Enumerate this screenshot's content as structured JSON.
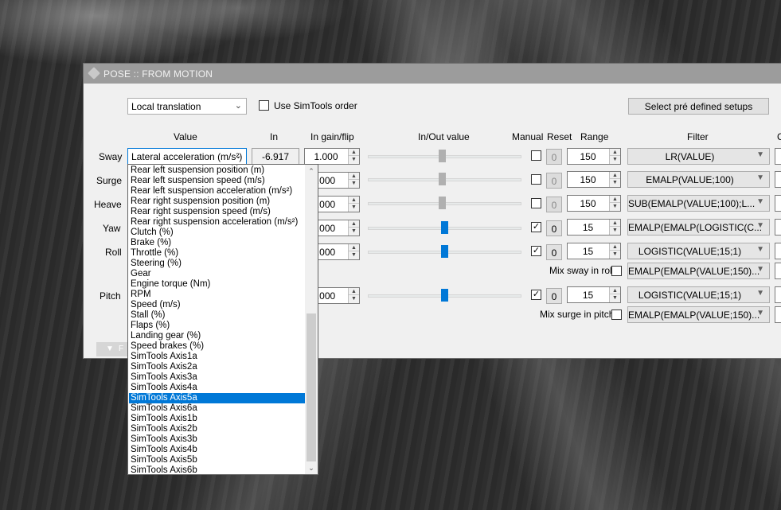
{
  "window": {
    "title": "POSE :: FROM MOTION"
  },
  "top": {
    "mode_value": "Local translation",
    "use_simtools_label": "Use SimTools order",
    "select_setups_label": "Select pré defined setups"
  },
  "headers": {
    "value": "Value",
    "in": "In",
    "in_gain": "In gain/flip",
    "inout": "In/Out value",
    "manual": "Manual",
    "reset": "Reset",
    "range": "Range",
    "filter": "Filter",
    "cut": "C"
  },
  "rows": [
    {
      "label": "Sway",
      "value": "Lateral acceleration (m/s²)",
      "in": "-6.917",
      "gain": "1.000",
      "manual_checked": false,
      "reset": "0",
      "range": "150",
      "filter": "LR(VALUE)",
      "inout_fraction": 0.55
    },
    {
      "label": "Surge",
      "gain": ".000",
      "manual_checked": false,
      "reset": "0",
      "range": "150",
      "filter": "EMALP(VALUE;100)",
      "inout_fraction": 0.55
    },
    {
      "label": "Heave",
      "gain": ".000",
      "manual_checked": false,
      "reset": "0",
      "range": "150",
      "filter": "SUB(EMALP(VALUE;100);L...",
      "inout_fraction": 0.55
    },
    {
      "label": "Yaw",
      "gain": ".000",
      "manual_checked": true,
      "reset": "0",
      "range": "15",
      "filter": "EMALP(EMALP(LOGISTIC(C...",
      "inout_fraction": 0.57
    },
    {
      "label": "Roll",
      "gain": ".000",
      "manual_checked": true,
      "reset": "0",
      "range": "15",
      "filter": "LOGISTIC(VALUE;15;1)",
      "inout_fraction": 0.57
    },
    {
      "label": "Pitch",
      "gain": ".000",
      "manual_checked": true,
      "reset": "0",
      "range": "15",
      "filter": "LOGISTIC(VALUE;15;1)",
      "inout_fraction": 0.57
    }
  ],
  "mix": {
    "sway_in_roll_label": "Mix sway in roll",
    "sway_in_roll_filter": "EMALP(EMALP(VALUE;150)...",
    "surge_in_pitch_label": "Mix surge in pitch",
    "surge_in_pitch_filter": "EMALP(EMALP(VALUE;150)..."
  },
  "collapsed_tab_label": "F",
  "dropdown": {
    "selected": "SimTools Axis5a",
    "items": [
      "Rear left suspension position (m)",
      "Rear left suspension speed (m/s)",
      "Rear left suspension acceleration (m/s²)",
      "Rear right suspension position (m)",
      "Rear right suspension speed (m/s)",
      "Rear right suspension acceleration (m/s²)",
      "Clutch (%)",
      "Brake (%)",
      "Throttle (%)",
      "Steering (%)",
      "Gear",
      "Engine torque (Nm)",
      "RPM",
      "Speed (m/s)",
      "Stall (%)",
      "Flaps (%)",
      "Landing gear (%)",
      "Speed brakes (%)",
      "SimTools Axis1a",
      "SimTools Axis2a",
      "SimTools Axis3a",
      "SimTools Axis4a",
      "SimTools Axis5a",
      "SimTools Axis6a",
      "SimTools Axis1b",
      "SimTools Axis2b",
      "SimTools Axis3b",
      "SimTools Axis4b",
      "SimTools Axis5b",
      "SimTools Axis6b"
    ]
  },
  "icons": {
    "dropdown_arrow": "chevron-down-icon",
    "filter_arrow": "triangle-down-icon",
    "spin_up": "triangle-up-icon",
    "spin_down": "triangle-down-icon",
    "checkmark": "check-icon"
  },
  "colors": {
    "accent": "#0078d7",
    "window_bg": "#f0f0f0",
    "titlebar": "#9c9c9c"
  }
}
